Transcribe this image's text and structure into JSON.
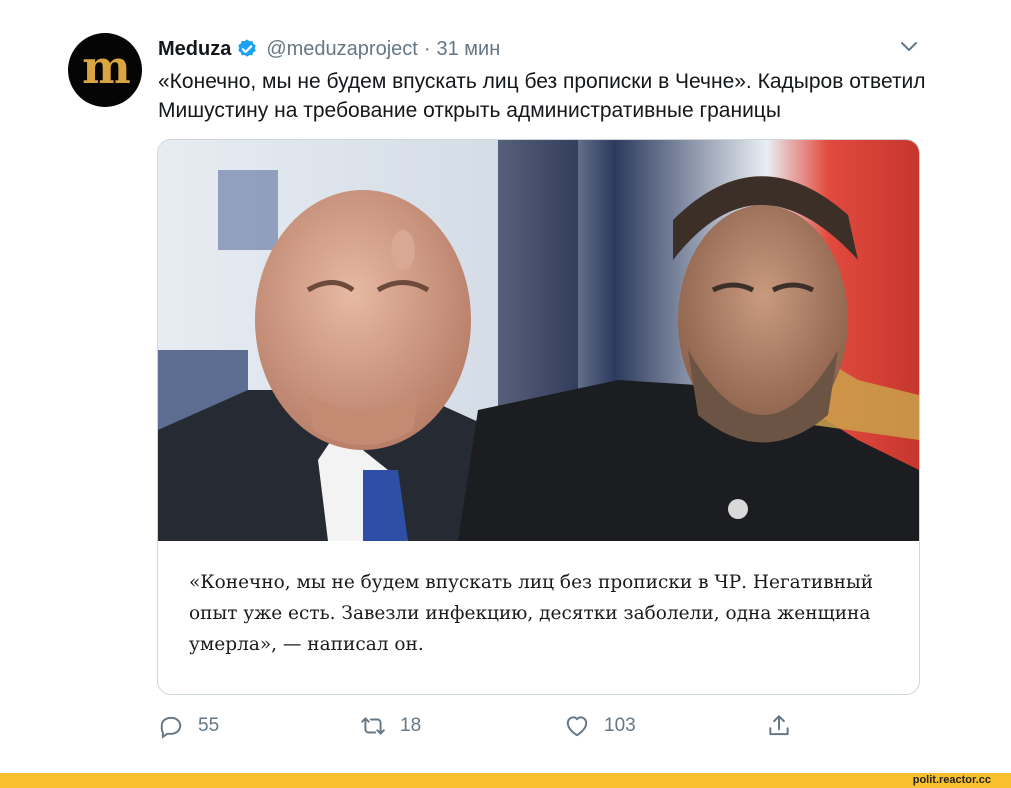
{
  "tweet": {
    "avatar_letter": "m",
    "author_name": "Meduza",
    "handle": "@meduzaproject",
    "separator": "·",
    "time": "31 мин",
    "text": "«Конечно, мы не будем впускать лиц без прописки в Чечне». Кадыров ответил Мишустину на требование открыть административные границы"
  },
  "card": {
    "quote": "«Конечно, мы не будем впускать лиц без прописки в ЧР. Негативный опыт уже есть. Завезли инфекцию, десятки заболели, одна женщина умерла», — написал он."
  },
  "actions": {
    "reply_count": "55",
    "retweet_count": "18",
    "like_count": "103"
  },
  "footer": {
    "watermark": "polit.reactor.cc"
  },
  "colors": {
    "accent": "#1da1f2",
    "muted": "#657786",
    "footer_bar": "#fbc02d"
  },
  "icons": [
    "verified-badge-icon",
    "chevron-down-icon",
    "reply-icon",
    "retweet-icon",
    "like-icon",
    "share-icon"
  ]
}
